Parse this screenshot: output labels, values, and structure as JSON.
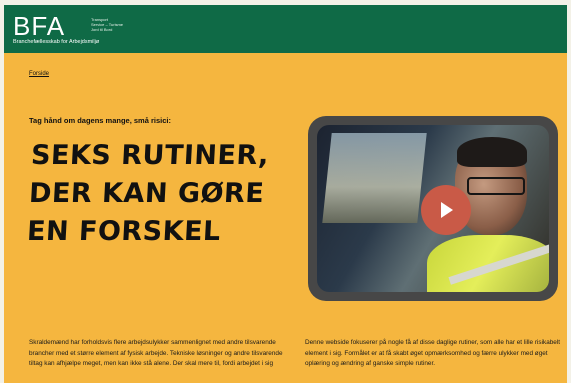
{
  "header": {
    "logo_text": "BFA",
    "logo_side_line1": "Transport",
    "logo_side_line2": "Service – Turisme",
    "logo_side_line3": "Jord til Bord",
    "logo_sub": "Branchefællesskab for Arbejdsmiljø",
    "color": "#0f6a46"
  },
  "breadcrumb": {
    "home": "Forside"
  },
  "hero": {
    "eyebrow": "Tag hånd om dagens mange, små risici:",
    "headline_lines": [
      "SEKS RUTINER,",
      "DER KAN GØRE",
      "EN FORSKEL"
    ],
    "background": "#f5b63f"
  },
  "video": {
    "play_icon": "play-icon",
    "play_color": "#c95a47"
  },
  "content": {
    "col1": "Skraldemænd har forholdsvis flere arbejdsulykker sammenlignet med andre tilsvarende brancher med et større element af fysisk arbejde. Tekniske løsninger og andre tilsvarende tiltag kan afhjælpe meget, men kan ikke stå alene. Der skal mere til, fordi arbejdet i sig",
    "col2": "Denne webside fokuserer på nogle få af disse daglige rutiner, som alle har et lille risikabelt element i sig. Formålet er at få skabt øget opmærksomhed og færre ulykker med øget oplæring og ændring af ganske simple rutiner."
  }
}
